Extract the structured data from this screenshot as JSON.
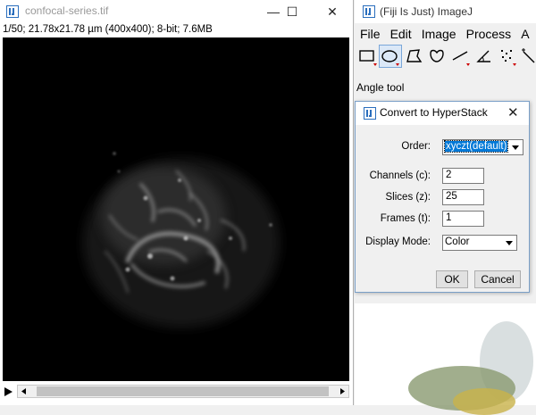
{
  "image_window": {
    "title": "confocal-series.tif",
    "info": "1/50; 21.78x21.78 µm (400x400); 8-bit; 7.6MB",
    "minimize_glyph": "—",
    "maximize_glyph": "☐",
    "close_glyph": "✕",
    "slice_position": 0.02,
    "icons": [
      "imagej-app-icon",
      "play-icon",
      "scroll-left-icon",
      "scroll-right-icon"
    ]
  },
  "imagej_window": {
    "title": "(Fiji Is Just) ImageJ",
    "menu": [
      "File",
      "Edit",
      "Image",
      "Process",
      "A"
    ],
    "tools": [
      "rectangle-tool-icon",
      "oval-tool-icon",
      "polygon-tool-icon",
      "freehand-tool-icon",
      "line-tool-icon",
      "angle-tool-icon",
      "multipoint-tool-icon",
      "wand-tool-icon"
    ],
    "active_tool": "oval-tool-icon",
    "status": "Angle tool"
  },
  "dialog": {
    "title": "Convert to HyperStack",
    "close_glyph": "✕",
    "order_label": "Order:",
    "order_value": "xyczt(default)",
    "channels_label": "Channels (c):",
    "channels_value": "2",
    "slices_label": "Slices (z):",
    "slices_value": "25",
    "frames_label": "Frames (t):",
    "frames_value": "1",
    "display_mode_label": "Display Mode:",
    "display_mode_value": "Color",
    "ok_label": "OK",
    "cancel_label": "Cancel"
  },
  "colors": {
    "selection_blue": "#0078d7",
    "image_background": "#000000",
    "window_chrome": "#f0f0f0"
  }
}
